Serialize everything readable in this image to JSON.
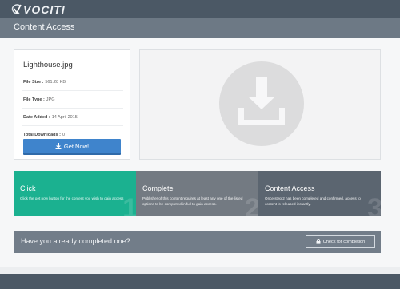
{
  "brand": {
    "logo_text": "VOCITI"
  },
  "header": {
    "title": "Content Access"
  },
  "file": {
    "name": "Lighthouse.jpg",
    "meta": [
      {
        "label": "File Size :",
        "value": "561.28 KB"
      },
      {
        "label": "File Type :",
        "value": "JPG"
      },
      {
        "label": "Date Added :",
        "value": "14 April 2015"
      },
      {
        "label": "Total Downloads :",
        "value": "0"
      }
    ],
    "button_label": "Get Now!"
  },
  "steps": [
    {
      "title": "Click",
      "desc": "Click the get now button for the content you wish to gain access",
      "number": "1"
    },
    {
      "title": "Complete",
      "desc": "Publisher of this content requires at least any one of the listed options to be completed in full to gain access.",
      "number": "2"
    },
    {
      "title": "Content Access",
      "desc": "Once step 2 has been completed and confirmed, access to content is released instantly.",
      "number": "3"
    }
  ],
  "check": {
    "prompt": "Have you already completed one?",
    "button_label": "Check for completion"
  },
  "colors": {
    "header_dark": "#4b5865",
    "header_light": "#6d7985",
    "button_blue": "#3f84cc",
    "step1_green": "#1bb190",
    "step2_gray": "#737a82",
    "step3_slate": "#5b6570"
  }
}
